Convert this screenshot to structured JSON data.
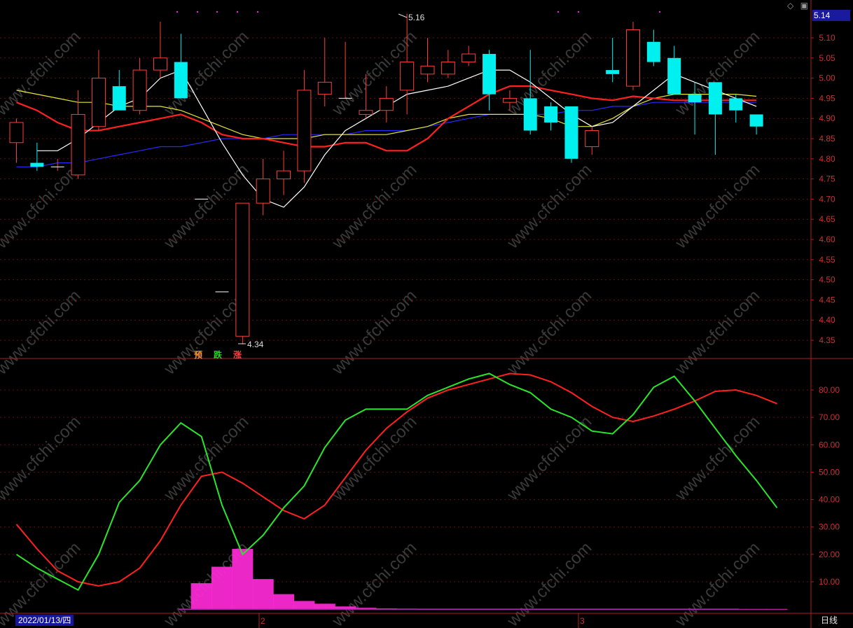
{
  "header": {
    "current_price": "5.14",
    "icons": [
      "diamond-icon",
      "restore-icon"
    ]
  },
  "footer": {
    "date": "2022/01/13/四",
    "period": "日线",
    "month_marks": [
      "2",
      "3"
    ]
  },
  "signals": [
    {
      "label": "预",
      "color": "#ff9a2a"
    },
    {
      "label": "跌",
      "color": "#28d228"
    },
    {
      "label": "涨",
      "color": "#ff4040"
    }
  ],
  "annotations": {
    "high": "5.16",
    "low": "4.34"
  },
  "watermark": "www.cfchi.com",
  "chart_data": [
    {
      "type": "candlestick",
      "title": "",
      "ylim": [
        4.3,
        5.18
      ],
      "yticks": [
        "5.10",
        "5.05",
        "5.00",
        "4.95",
        "4.90",
        "4.85",
        "4.80",
        "4.75",
        "4.70",
        "4.65",
        "4.60",
        "4.55",
        "4.50",
        "4.45",
        "4.40",
        "4.35"
      ],
      "colors": {
        "up": "#ff3c3c",
        "down": "#00f0f0",
        "ma5": "#ffffff",
        "ma10": "#e6e632",
        "ma20": "#ff2020",
        "ma60": "#2828ff"
      },
      "candles": [
        {
          "o": 4.84,
          "h": 4.9,
          "l": 4.79,
          "c": 4.89
        },
        {
          "o": 4.79,
          "h": 4.84,
          "l": 4.77,
          "c": 4.78
        },
        {
          "o": 4.78,
          "h": 4.8,
          "l": 4.77,
          "c": 4.78
        },
        {
          "o": 4.76,
          "h": 4.97,
          "l": 4.75,
          "c": 4.91
        },
        {
          "o": 4.88,
          "h": 5.07,
          "l": 4.87,
          "c": 5.0
        },
        {
          "o": 4.98,
          "h": 5.02,
          "l": 4.92,
          "c": 4.92
        },
        {
          "o": 4.92,
          "h": 5.05,
          "l": 4.91,
          "c": 5.02
        },
        {
          "o": 5.02,
          "h": 5.14,
          "l": 5.0,
          "c": 5.05
        },
        {
          "o": 5.04,
          "h": 5.11,
          "l": 4.95,
          "c": 4.95
        },
        {
          "o": 4.7,
          "h": 4.7,
          "l": 4.7,
          "c": 4.7
        },
        {
          "o": 4.47,
          "h": 4.47,
          "l": 4.47,
          "c": 4.47
        },
        {
          "o": 4.36,
          "h": 4.69,
          "l": 4.34,
          "c": 4.69
        },
        {
          "o": 4.69,
          "h": 4.8,
          "l": 4.66,
          "c": 4.75
        },
        {
          "o": 4.75,
          "h": 4.82,
          "l": 4.71,
          "c": 4.77
        },
        {
          "o": 4.77,
          "h": 5.02,
          "l": 4.74,
          "c": 4.97
        },
        {
          "o": 4.96,
          "h": 5.1,
          "l": 4.93,
          "c": 4.99
        },
        {
          "o": 4.95,
          "h": 5.09,
          "l": 4.95,
          "c": 4.95
        },
        {
          "o": 4.91,
          "h": 5.01,
          "l": 4.9,
          "c": 4.92
        },
        {
          "o": 4.92,
          "h": 4.98,
          "l": 4.89,
          "c": 4.95
        },
        {
          "o": 4.97,
          "h": 5.16,
          "l": 4.91,
          "c": 5.04
        },
        {
          "o": 5.01,
          "h": 5.1,
          "l": 4.99,
          "c": 5.03
        },
        {
          "o": 5.01,
          "h": 5.07,
          "l": 5.0,
          "c": 5.04
        },
        {
          "o": 5.04,
          "h": 5.08,
          "l": 5.03,
          "c": 5.06
        },
        {
          "o": 5.06,
          "h": 5.07,
          "l": 4.92,
          "c": 4.96
        },
        {
          "o": 4.94,
          "h": 4.97,
          "l": 4.92,
          "c": 4.95
        },
        {
          "o": 4.95,
          "h": 5.07,
          "l": 4.86,
          "c": 4.87
        },
        {
          "o": 4.93,
          "h": 4.94,
          "l": 4.87,
          "c": 4.89
        },
        {
          "o": 4.93,
          "h": 4.93,
          "l": 4.79,
          "c": 4.8
        },
        {
          "o": 4.83,
          "h": 4.88,
          "l": 4.81,
          "c": 4.87
        },
        {
          "o": 5.02,
          "h": 5.1,
          "l": 4.99,
          "c": 5.01
        },
        {
          "o": 4.98,
          "h": 5.14,
          "l": 4.97,
          "c": 5.12
        },
        {
          "o": 5.09,
          "h": 5.12,
          "l": 5.03,
          "c": 5.04
        },
        {
          "o": 5.05,
          "h": 5.08,
          "l": 4.96,
          "c": 4.96
        },
        {
          "o": 4.96,
          "h": 4.99,
          "l": 4.86,
          "c": 4.94
        },
        {
          "o": 4.99,
          "h": 4.99,
          "l": 4.81,
          "c": 4.91
        },
        {
          "o": 4.95,
          "h": 4.96,
          "l": 4.89,
          "c": 4.92
        },
        {
          "o": 4.91,
          "h": 4.91,
          "l": 4.86,
          "c": 4.88
        }
      ],
      "ma5": [
        null,
        4.82,
        4.82,
        4.85,
        4.89,
        4.93,
        4.95,
        5.0,
        5.02,
        4.93,
        4.84,
        4.76,
        4.7,
        4.68,
        4.73,
        4.81,
        4.87,
        4.9,
        4.93,
        4.96,
        4.97,
        4.98,
        5.0,
        5.02,
        5.02,
        4.99,
        4.95,
        4.91,
        4.88,
        4.89,
        4.93,
        4.97,
        5.01,
        4.99,
        4.97,
        4.95,
        4.93
      ],
      "ma10": [
        4.97,
        4.96,
        4.95,
        4.94,
        4.94,
        4.93,
        4.93,
        4.93,
        4.92,
        4.9,
        4.88,
        4.86,
        4.85,
        4.85,
        4.85,
        4.86,
        4.86,
        4.86,
        4.86,
        4.87,
        4.88,
        4.9,
        4.91,
        4.91,
        4.91,
        4.91,
        4.9,
        4.88,
        4.88,
        4.9,
        4.93,
        4.95,
        4.96,
        4.96,
        4.96,
        4.96,
        4.955
      ],
      "ma20": [
        4.94,
        4.92,
        4.89,
        4.87,
        4.87,
        4.88,
        4.89,
        4.9,
        4.91,
        4.89,
        4.86,
        4.85,
        4.85,
        4.84,
        4.83,
        4.83,
        4.84,
        4.84,
        4.82,
        4.82,
        4.85,
        4.9,
        4.93,
        4.96,
        4.98,
        4.98,
        4.97,
        4.96,
        4.95,
        4.945,
        4.955,
        4.95,
        4.945,
        4.945,
        4.945,
        4.945,
        4.945
      ],
      "ma60": [
        4.78,
        4.78,
        4.79,
        4.79,
        4.8,
        4.81,
        4.82,
        4.83,
        4.83,
        4.84,
        4.85,
        4.85,
        4.85,
        4.86,
        4.86,
        4.86,
        4.86,
        4.87,
        4.87,
        4.87,
        4.88,
        4.89,
        4.9,
        4.91,
        4.91,
        4.91,
        4.91,
        4.92,
        4.92,
        4.93,
        4.93,
        4.94,
        4.94,
        4.94,
        4.94,
        4.94,
        4.94
      ]
    },
    {
      "type": "line",
      "title": "",
      "ylim": [
        0,
        91
      ],
      "yticks": [
        "80.00",
        "70.00",
        "60.00",
        "50.00",
        "40.00",
        "30.00",
        "20.00",
        "10.00"
      ],
      "series": [
        {
          "color": "#ff2020",
          "values": [
            31,
            22,
            14,
            10,
            8.5,
            10,
            15,
            25,
            38,
            48.5,
            50,
            46,
            41,
            36,
            33,
            38,
            48,
            58,
            66,
            72,
            77,
            80,
            82,
            84,
            86,
            85.5,
            83,
            79,
            74,
            70,
            68.5,
            70.5,
            73,
            76,
            79.5,
            80,
            78,
            75
          ]
        },
        {
          "color": "#28e628",
          "values": [
            20,
            15,
            11,
            7,
            20,
            39,
            47,
            60,
            68,
            63,
            38,
            20,
            27,
            37,
            45,
            59,
            69,
            73,
            73,
            73,
            78,
            81,
            84,
            86,
            82,
            79,
            73,
            70,
            65,
            64,
            71,
            81,
            85,
            76,
            66,
            56,
            47,
            37
          ]
        }
      ],
      "histogram": [
        0,
        0,
        0,
        0,
        0,
        0,
        0,
        0,
        0,
        9.5,
        15.5,
        22,
        11,
        5.5,
        3,
        2,
        1,
        0.5,
        0.3,
        0.2,
        0.1,
        0.1,
        0.1,
        0.1,
        0.1,
        0.1,
        0.1,
        0.1,
        0.1,
        0.1,
        0.1,
        0.1,
        0.1,
        0.1,
        0.1,
        0.1,
        0.1,
        0.1
      ]
    }
  ]
}
